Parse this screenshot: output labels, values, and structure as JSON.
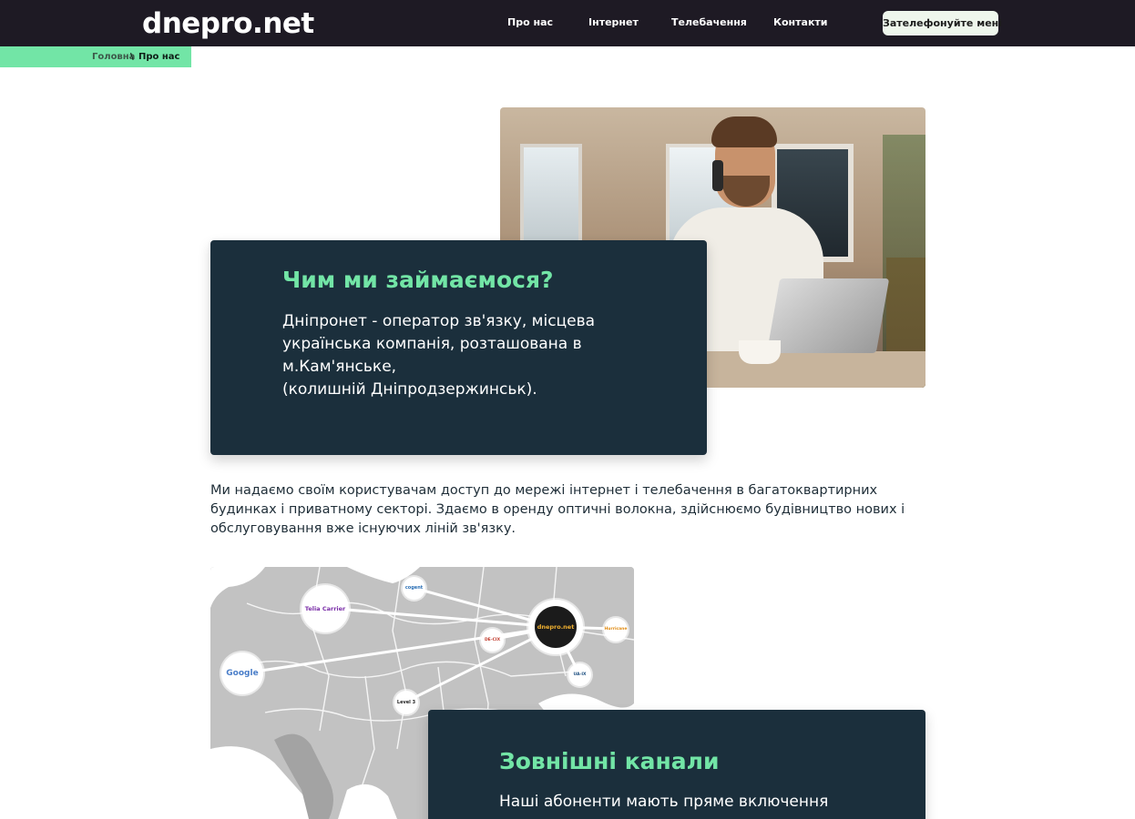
{
  "header": {
    "logo": "dnepro.net",
    "nav": [
      "Про нас",
      "Інтернет",
      "Телебачення",
      "Контакти"
    ],
    "cta": "Зателефонуйте мені"
  },
  "breadcrumb": {
    "home": "Головна",
    "separator": "\\",
    "current": "Про нас"
  },
  "hero": {
    "title": "Чим ми займаємося?",
    "lines": [
      "Дніпронет - оператор зв'язку, місцева",
      "українська компанія, розташована в",
      "м.Кам'янське,",
      "(колишній Дніпродзержинськ)."
    ]
  },
  "intro": "Ми надаємо своїм користувачам доступ до мережі інтернет і телебачення в багатоквартирних будинках і приватному секторі. Здаємо в оренду оптичні волокна, здійснюємо будівництво нових і обслуговування вже існуючих ліній зв'язку.",
  "channels": {
    "title": "Зовнішні канали",
    "text": "Наші абоненти мають пряме включення"
  },
  "map": {
    "center": "dnepro.net",
    "partners": [
      "Telia Carrier",
      "cogent",
      "Google",
      "Level 3",
      "DE-CIX",
      "UA-IX",
      "Hurricane"
    ]
  },
  "colors": {
    "header_bg": "#1e1a24",
    "accent": "#72e5a6",
    "card_bg": "#1b2f3c"
  }
}
